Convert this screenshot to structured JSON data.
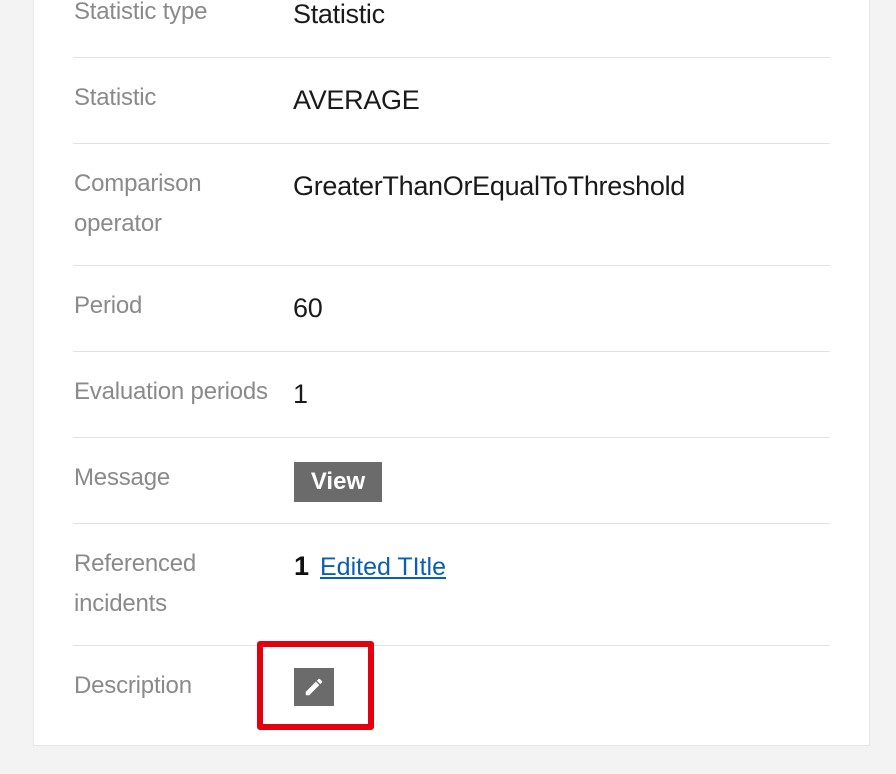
{
  "details": {
    "rows": [
      {
        "label": "Statistic type",
        "value": "Statistic"
      },
      {
        "label": "Statistic",
        "value": "AVERAGE"
      },
      {
        "label": "Comparison operator",
        "label_line1": "Comparison",
        "label_line2": "operator",
        "value": "GreaterThanOrEqualToThreshold"
      },
      {
        "label": "Period",
        "value": "60"
      },
      {
        "label": "Evaluation periods",
        "value": "1"
      },
      {
        "label": "Message",
        "button_label": "View"
      },
      {
        "label": "Referenced incidents",
        "label_line1": "Referenced",
        "label_line2": "incidents",
        "count": "1",
        "link_text": "Edited TItle"
      },
      {
        "label": "Description"
      }
    ]
  },
  "colors": {
    "page_background": "#f3f3f3",
    "card_background": "#ffffff",
    "label_text": "#8a8a8a",
    "value_text": "#1a1a1a",
    "button_background": "#6b6b6b",
    "link": "#0a5fb4",
    "highlight_border": "#e3000f"
  },
  "icons": {
    "edit": "pencil-icon"
  }
}
